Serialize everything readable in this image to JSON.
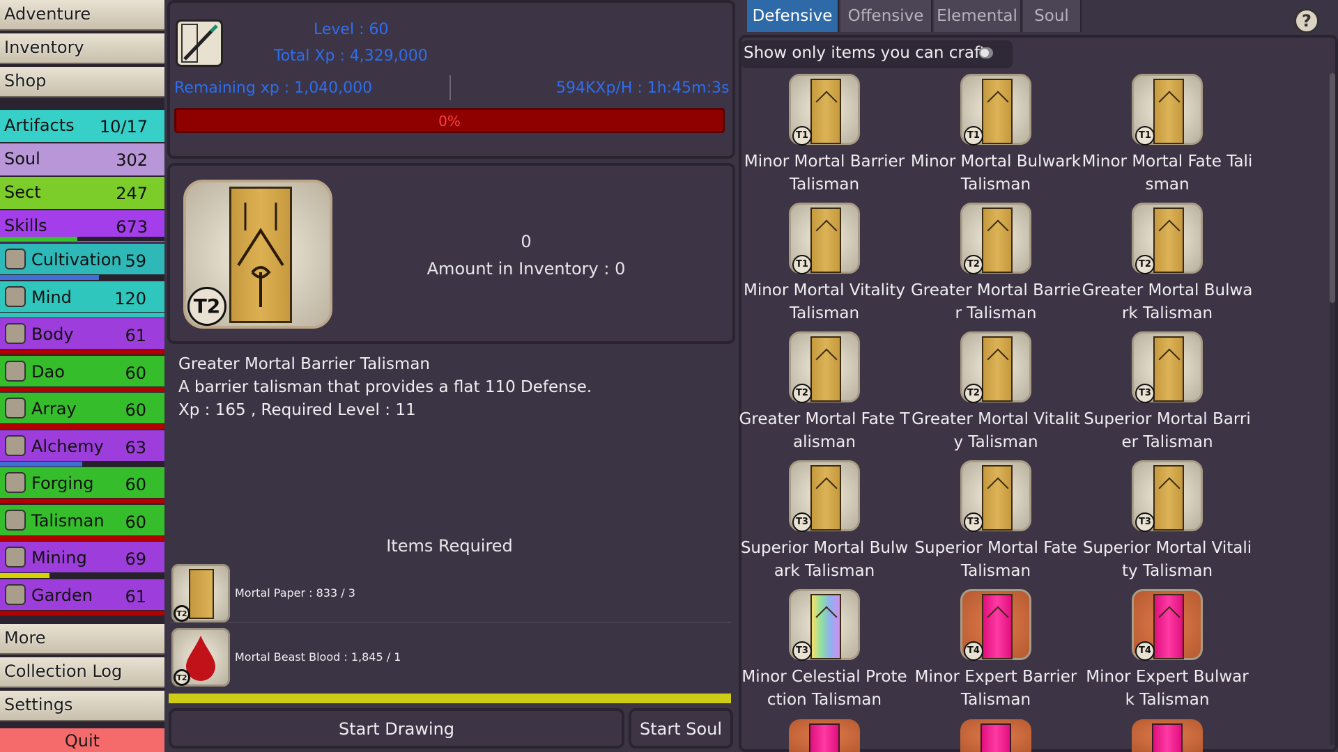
{
  "sidebar": {
    "nav_top": [
      "Adventure",
      "Inventory",
      "Shop"
    ],
    "stats": [
      {
        "label": "Artifacts",
        "value": "10/17",
        "color": "#37d0c8"
      },
      {
        "label": "Soul",
        "value": "302",
        "color": "#b896d8"
      },
      {
        "label": "Sect",
        "value": "247",
        "color": "#7ccd2a"
      },
      {
        "label": "Skills",
        "value": "673",
        "color": "#a43dea"
      }
    ],
    "skills_progress": 0.47,
    "skills": [
      {
        "label": "Cultivation",
        "value": "59",
        "bg": "#2fb8b8",
        "bar": "#3f6fd4",
        "progress": 0.6,
        "icon": "cultivation-icon"
      },
      {
        "label": "Mind",
        "value": "120",
        "bg": "#2fc7bd",
        "bar": "#2fc7bd",
        "progress": 1.0,
        "icon": "mind-icon"
      },
      {
        "label": "Body",
        "value": "61",
        "bg": "#9d3ddb",
        "bar": "#b00000",
        "progress": 1.0,
        "icon": "body-icon"
      },
      {
        "label": "Dao",
        "value": "60",
        "bg": "#36bd2c",
        "bar": "#b00000",
        "progress": 1.0,
        "icon": "yin-yang-icon"
      },
      {
        "label": "Array",
        "value": "60",
        "bg": "#36bd2c",
        "bar": "#b00000",
        "progress": 1.0,
        "icon": "array-icon"
      },
      {
        "label": "Alchemy",
        "value": "63",
        "bg": "#9d3ddb",
        "bar": "#3f6fd4",
        "progress": 0.5,
        "icon": "alchemy-icon"
      },
      {
        "label": "Forging",
        "value": "60",
        "bg": "#36bd2c",
        "bar": "#b00000",
        "progress": 1.0,
        "icon": "anvil-icon"
      },
      {
        "label": "Talisman",
        "value": "60",
        "bg": "#36bd2c",
        "bar": "#b00000",
        "progress": 1.0,
        "icon": "talisman-icon"
      },
      {
        "label": "Mining",
        "value": "69",
        "bg": "#9d3ddb",
        "bar": "#d6d000",
        "progress": 0.3,
        "icon": "pickaxe-icon"
      },
      {
        "label": "Garden",
        "value": "61",
        "bg": "#9d3ddb",
        "bar": "#b00000",
        "progress": 1.0,
        "icon": "garden-icon"
      }
    ],
    "nav_bottom": [
      "More",
      "Collection Log",
      "Settings"
    ],
    "quit": "Quit"
  },
  "header": {
    "level": "Level : 60",
    "total_xp": "Total Xp : 4,329,000",
    "remaining_xp": "Remaining xp : 1,040,000",
    "rate": "594KXp/H : 1h:45m:3s",
    "progress_label": "0%",
    "progress": 0
  },
  "detail": {
    "tier": "T2",
    "count": "0",
    "inventory": "Amount in Inventory : 0",
    "name": "Greater Mortal Barrier Talisman",
    "description": "A barrier talisman that provides a flat 110 Defense.",
    "xp_req": "Xp : 165 , Required Level : 11",
    "items_required_title": "Items Required",
    "requirements": [
      {
        "label": "Mortal Paper : 833 / 3",
        "tier": "T2"
      },
      {
        "label": "Mortal Beast Blood : 1,845 / 1",
        "tier": "T2"
      }
    ],
    "start_drawing": "Start Drawing",
    "start_soul": "Start Soul"
  },
  "tabs": [
    "Defensive",
    "Offensive",
    "Elemental",
    "Soul"
  ],
  "active_tab": 0,
  "help": "?",
  "filter_label": "Show only items you can craft",
  "grid": [
    {
      "name": "Minor Mortal Barrier Talisman",
      "tier": "T1",
      "style": "gold"
    },
    {
      "name": "Minor Mortal Bulwark Talisman",
      "tier": "T1",
      "style": "gold"
    },
    {
      "name": "Minor Mortal Fate Talisman",
      "tier": "T1",
      "style": "gold"
    },
    {
      "name": "Minor Mortal Vitality Talisman",
      "tier": "T1",
      "style": "gold"
    },
    {
      "name": "Greater Mortal Barrier Talisman",
      "tier": "T2",
      "style": "gold"
    },
    {
      "name": "Greater Mortal Bulwark Talisman",
      "tier": "T2",
      "style": "gold"
    },
    {
      "name": "Greater Mortal Fate Talisman",
      "tier": "T2",
      "style": "gold"
    },
    {
      "name": "Greater Mortal Vitality Talisman",
      "tier": "T2",
      "style": "gold"
    },
    {
      "name": "Superior Mortal Barrier Talisman",
      "tier": "T3",
      "style": "gold"
    },
    {
      "name": "Superior Mortal Bulwark Talisman",
      "tier": "T3",
      "style": "gold"
    },
    {
      "name": "Superior Mortal Fate Talisman",
      "tier": "T3",
      "style": "gold"
    },
    {
      "name": "Superior Mortal Vitality Talisman",
      "tier": "T3",
      "style": "gold"
    },
    {
      "name": "Minor Celestial Protection Talisman",
      "tier": "T3",
      "style": "rainbow"
    },
    {
      "name": "Minor Expert Barrier Talisman",
      "tier": "T4",
      "style": "pink"
    },
    {
      "name": "Minor Expert Bulwark Talisman",
      "tier": "T4",
      "style": "pink"
    }
  ]
}
